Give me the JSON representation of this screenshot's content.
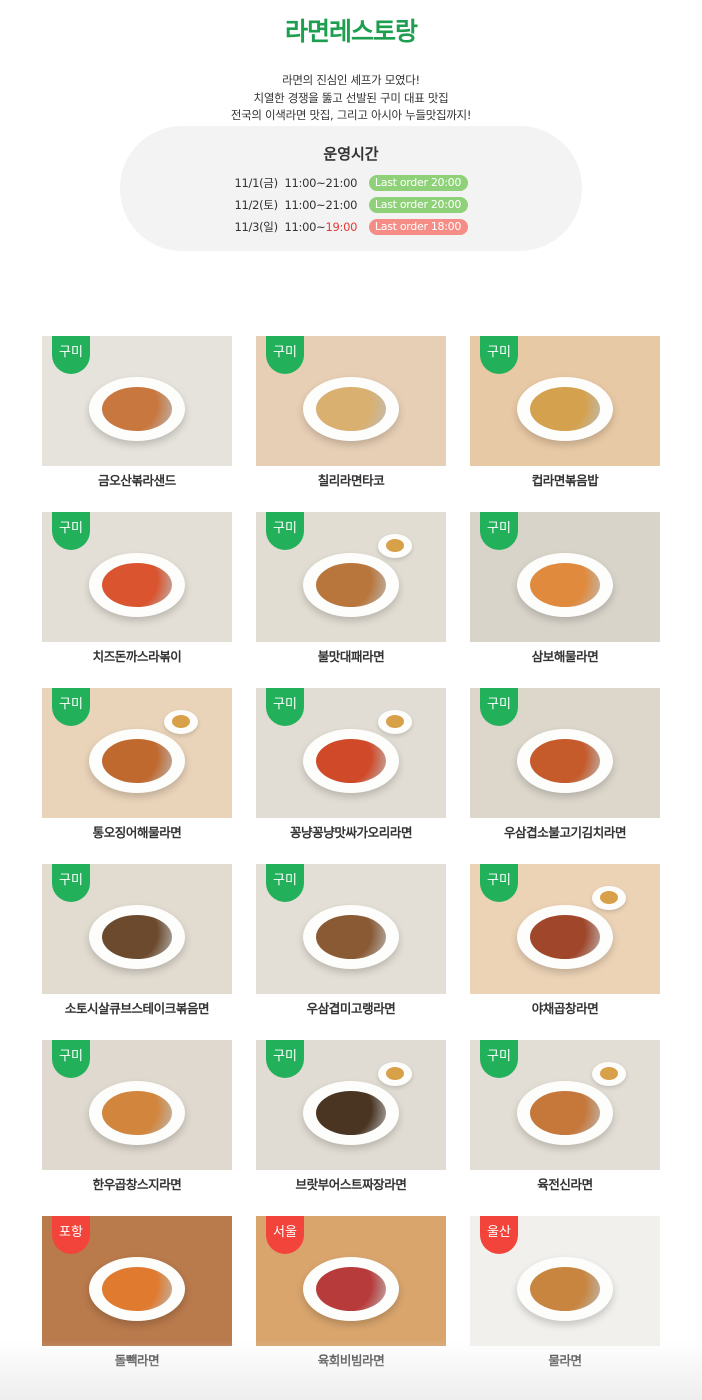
{
  "header": {
    "title": "라면레스토랑",
    "intro": [
      "라면의 진심인 셰프가 모였다!",
      "치열한 경쟁을 뚫고 선발된 구미 대표 맛집",
      "전국의 이색라면 맛집, 그리고 아시아 누들맛집까지!"
    ]
  },
  "hours": {
    "title": "운영시간",
    "rows": [
      {
        "date": "11/1(금)",
        "time_start": "11:00~",
        "time_end": "21:00",
        "time_end_red": false,
        "last_order": "Last order 20:00",
        "status": "green"
      },
      {
        "date": "11/2(토)",
        "time_start": "11:00~",
        "time_end": "21:00",
        "time_end_red": false,
        "last_order": "Last order 20:00",
        "status": "green"
      },
      {
        "date": "11/3(일)",
        "time_start": "11:00~",
        "time_end": "19:00",
        "time_end_red": true,
        "last_order": "Last order 18:00",
        "status": "red"
      }
    ]
  },
  "menu": [
    {
      "region": "구미",
      "name": "금오산볶라샌드",
      "tag_color": "green",
      "bg": "#e6e3dc",
      "food": "#c8783f",
      "side": false
    },
    {
      "region": "구미",
      "name": "칠리라면타코",
      "tag_color": "green",
      "bg": "#e7cfb5",
      "food": "#d9b070",
      "side": false
    },
    {
      "region": "구미",
      "name": "컵라면볶음밥",
      "tag_color": "green",
      "bg": "#e8c9a5",
      "food": "#d4a24e",
      "side": false
    },
    {
      "region": "구미",
      "name": "치즈돈까스라볶이",
      "tag_color": "green",
      "bg": "#e4dfd6",
      "food": "#d9542f",
      "side": false
    },
    {
      "region": "구미",
      "name": "불맛대패라면",
      "tag_color": "green",
      "bg": "#e2ddd3",
      "food": "#b9763c",
      "side": true
    },
    {
      "region": "구미",
      "name": "삼보해물라면",
      "tag_color": "green",
      "bg": "#d9d4ca",
      "food": "#e08a3d",
      "side": false
    },
    {
      "region": "구미",
      "name": "통오징어해물라면",
      "tag_color": "green",
      "bg": "#e9d3b9",
      "food": "#c0692f",
      "side": true
    },
    {
      "region": "구미",
      "name": "꽁냥꽁냥맛싸가오리라면",
      "tag_color": "green",
      "bg": "#e2ddd4",
      "food": "#d04a2a",
      "side": true
    },
    {
      "region": "구미",
      "name": "우삼겹소불고기김치라면",
      "tag_color": "green",
      "bg": "#dcd6cb",
      "food": "#c55a2b",
      "side": false
    },
    {
      "region": "구미",
      "name": "소토시살큐브스테이크볶음면",
      "tag_color": "green",
      "bg": "#e1dbd0",
      "food": "#6b4a2e",
      "side": false
    },
    {
      "region": "구미",
      "name": "우삼겹미고랭라면",
      "tag_color": "green",
      "bg": "#e4dfd6",
      "food": "#8a5a35",
      "side": false
    },
    {
      "region": "구미",
      "name": "야채곱창라면",
      "tag_color": "green",
      "bg": "#ecd3b6",
      "food": "#a0462a",
      "side": true
    },
    {
      "region": "구미",
      "name": "한우곱창스지라면",
      "tag_color": "green",
      "bg": "#dfd9cf",
      "food": "#d2853d",
      "side": false
    },
    {
      "region": "구미",
      "name": "브랏부어스트짜장라면",
      "tag_color": "green",
      "bg": "#e1dcd3",
      "food": "#4a3422",
      "side": true
    },
    {
      "region": "구미",
      "name": "육전신라면",
      "tag_color": "green",
      "bg": "#e3ded5",
      "food": "#c6773a",
      "side": true
    },
    {
      "region": "포항",
      "name": "돌빽라면",
      "tag_color": "red",
      "bg": "#b97a4c",
      "food": "#e07a2e",
      "side": false
    },
    {
      "region": "서울",
      "name": "육회비빔라면",
      "tag_color": "red",
      "bg": "#d9a56d",
      "food": "#b83b3b",
      "side": false
    },
    {
      "region": "울산",
      "name": "물라면",
      "tag_color": "red",
      "bg": "#f1f0ec",
      "food": "#c8853f",
      "side": false
    }
  ]
}
